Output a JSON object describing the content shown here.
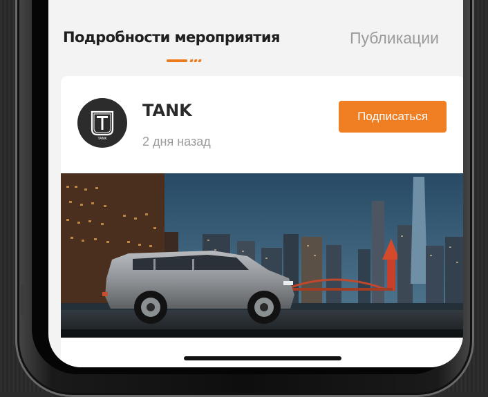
{
  "tabs": [
    {
      "label": "Подробности мероприятия",
      "active": true
    },
    {
      "label": "Публикации",
      "active": false
    }
  ],
  "post": {
    "author": "TANK",
    "avatar_badge": "TANK",
    "time": "2 дня назад",
    "subscribe_label": "Подписаться",
    "image_alt": "city-night-suv-photo"
  },
  "colors": {
    "accent": "#ef7f22",
    "text_primary": "#1f1f1f",
    "text_secondary": "#9a9a9a",
    "screen_bg": "#f3f3f3"
  }
}
